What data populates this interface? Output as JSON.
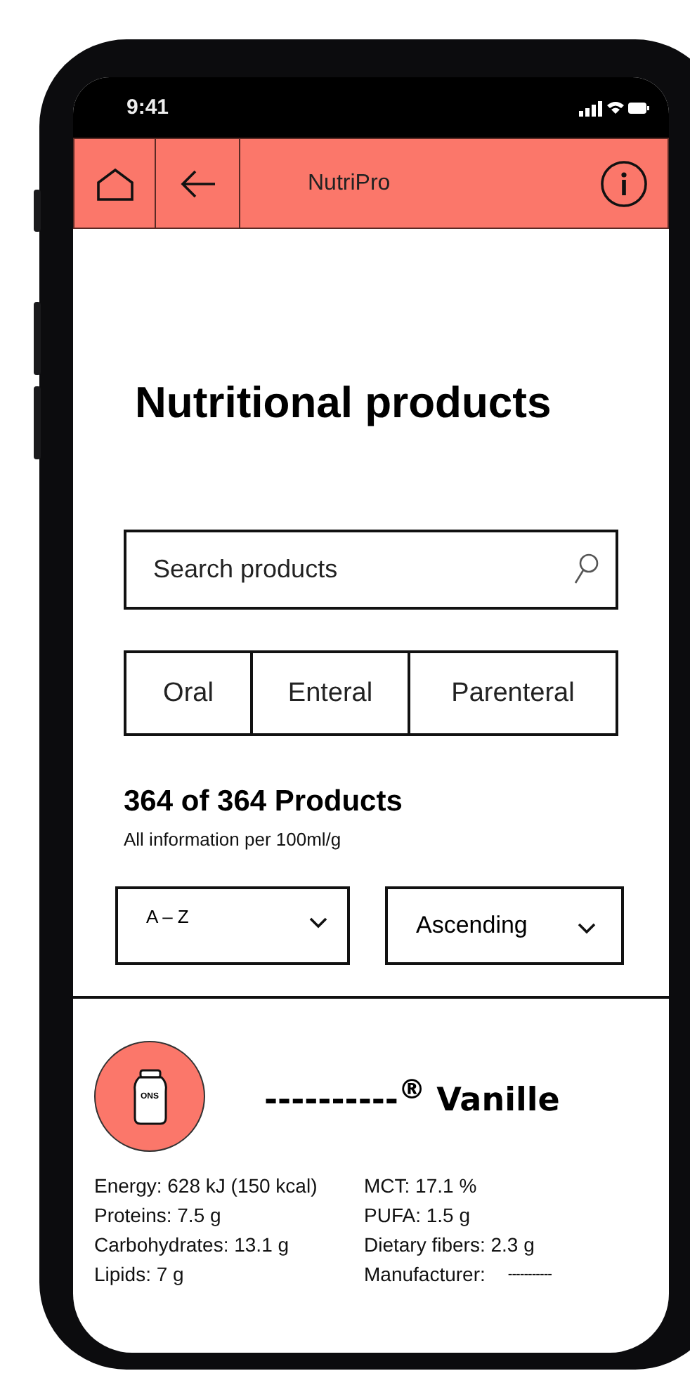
{
  "status_bar": {
    "time": "9:41"
  },
  "header": {
    "title": "NutriPro"
  },
  "page": {
    "title": "Nutritional products"
  },
  "search": {
    "placeholder": "Search products"
  },
  "tabs": [
    {
      "label": "Oral",
      "selected": false
    },
    {
      "label": "Enteral",
      "selected": false
    },
    {
      "label": "Parenteral",
      "selected": false
    }
  ],
  "results": {
    "count": "364 of 364 Products",
    "note": "All information per 100ml/g"
  },
  "sort": [
    {
      "value": "A – Z"
    },
    {
      "value": "Ascending"
    }
  ],
  "product": {
    "icon_label": "ONS",
    "name": "----------$^{®}$ Vanille",
    "nutrients_left": [
      "Energy: 628 kJ (150 kcal)",
      "Proteins: 7.5 g",
      "Carbohydrates: 13.1 g",
      "Lipids: 7 g"
    ],
    "nutrients_right": [
      "MCT: 17.1 %",
      "PUFA: 1.5 g",
      "Dietary fibers: 2.3 g"
    ],
    "manufacturer_label": "Manufacturer:",
    "manufacturer_value": "-----------"
  }
}
